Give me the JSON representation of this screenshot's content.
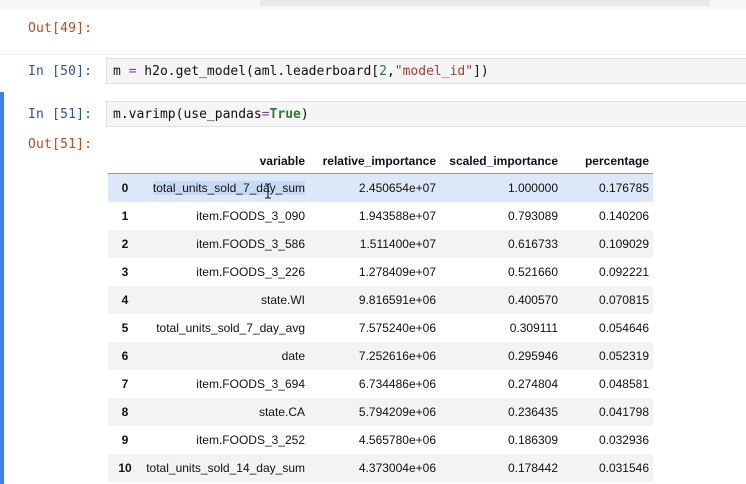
{
  "cells": {
    "out49": {
      "prompt": "Out[49]:"
    },
    "in50": {
      "prompt": "In [50]:",
      "code": {
        "a": "m ",
        "b": "=",
        "c": " h2o.get_model(aml.leaderboard[",
        "d": "2",
        "e": ",",
        "f": "\"model_id\"",
        "g": "])"
      }
    },
    "in51": {
      "prompt": "In [51]:",
      "code": {
        "a": "m.varimp(use_pandas",
        "b": "=",
        "c": "True",
        "d": ")"
      }
    },
    "out51": {
      "prompt": "Out[51]:"
    }
  },
  "table": {
    "columns": [
      "",
      "variable",
      "relative_importance",
      "scaled_importance",
      "percentage"
    ],
    "rows": [
      [
        "0",
        "total_units_sold_7_day_sum",
        "2.450654e+07",
        "1.000000",
        "0.176785"
      ],
      [
        "1",
        "item.FOODS_3_090",
        "1.943588e+07",
        "0.793089",
        "0.140206"
      ],
      [
        "2",
        "item.FOODS_3_586",
        "1.511400e+07",
        "0.616733",
        "0.109029"
      ],
      [
        "3",
        "item.FOODS_3_226",
        "1.278409e+07",
        "0.521660",
        "0.092221"
      ],
      [
        "4",
        "state.WI",
        "9.816591e+06",
        "0.400570",
        "0.070815"
      ],
      [
        "5",
        "total_units_sold_7_day_avg",
        "7.575240e+06",
        "0.309111",
        "0.054646"
      ],
      [
        "6",
        "date",
        "7.252616e+06",
        "0.295946",
        "0.052319"
      ],
      [
        "7",
        "item.FOODS_3_694",
        "6.734486e+06",
        "0.274804",
        "0.048581"
      ],
      [
        "8",
        "state.CA",
        "5.794209e+06",
        "0.236435",
        "0.041798"
      ],
      [
        "9",
        "item.FOODS_3_252",
        "4.565780e+06",
        "0.186309",
        "0.032936"
      ],
      [
        "10",
        "total_units_sold_14_day_sum",
        "4.373004e+06",
        "0.178442",
        "0.031546"
      ]
    ]
  },
  "icons": {
    "cursor": "text-cursor-icon"
  },
  "colors": {
    "active_cell_bar": "#3b82f6",
    "selected_row": "#dce8f7"
  }
}
